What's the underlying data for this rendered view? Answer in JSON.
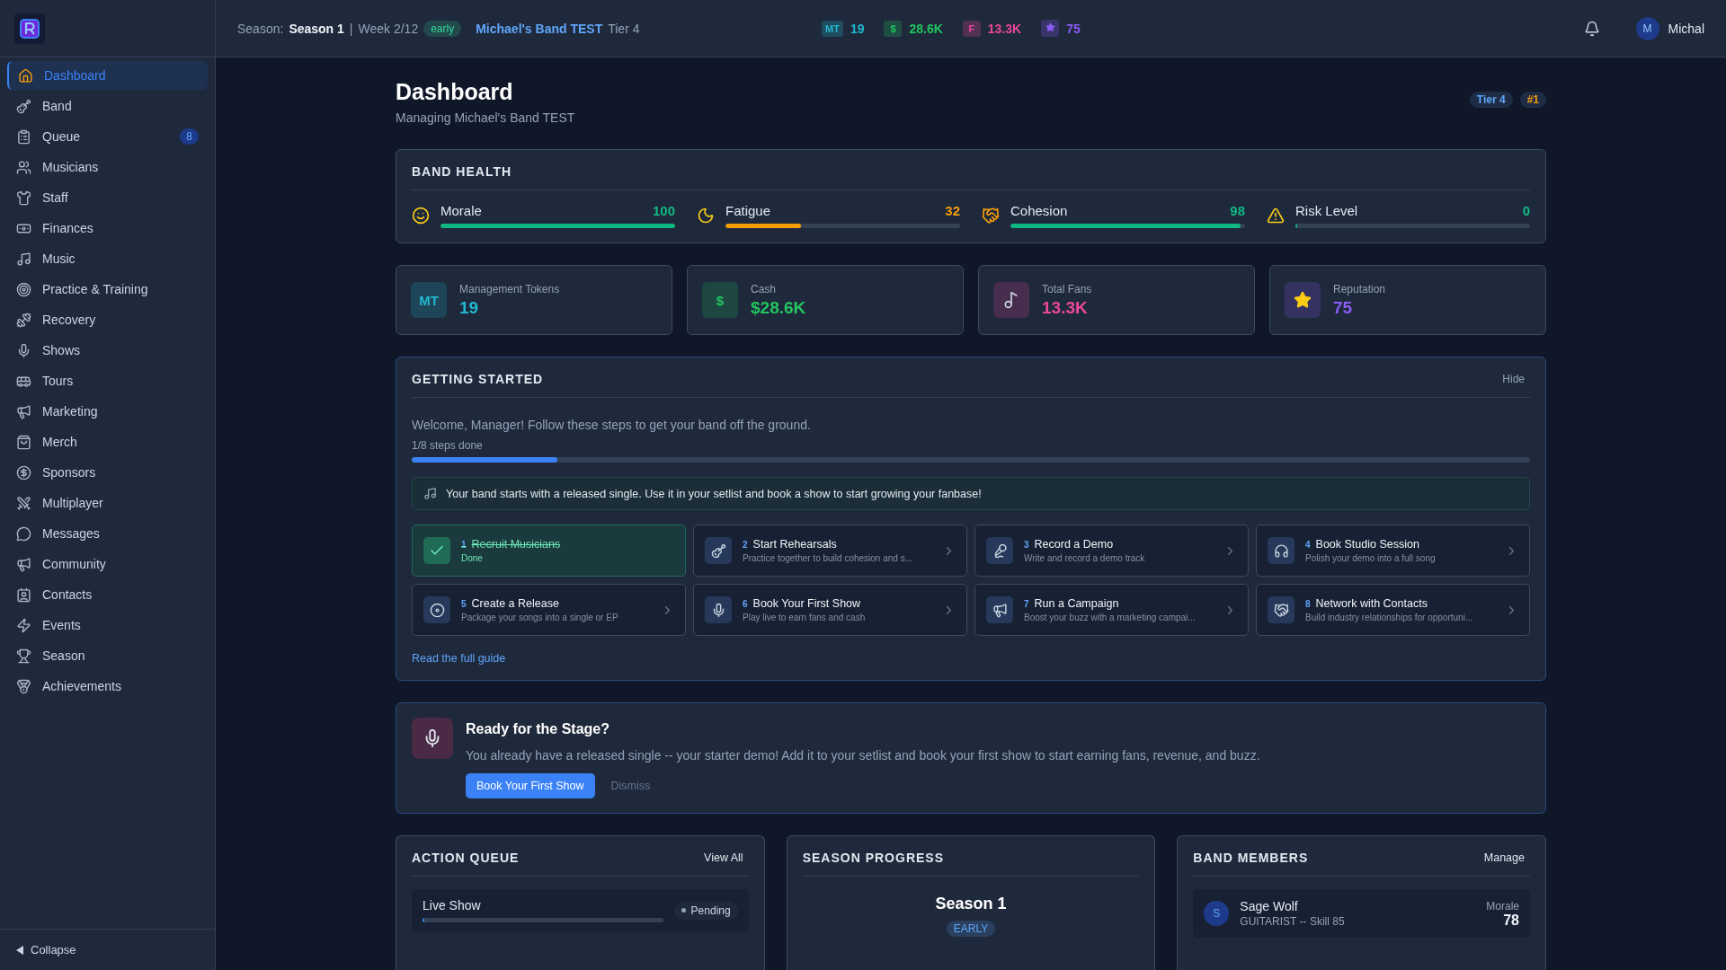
{
  "sidebar": {
    "items": [
      {
        "label": "Dashboard",
        "selected": true
      },
      {
        "label": "Band",
        "selected": false
      },
      {
        "label": "Queue",
        "selected": false,
        "badge": "8"
      },
      {
        "label": "Musicians",
        "selected": false
      },
      {
        "label": "Staff",
        "selected": false
      },
      {
        "label": "Finances",
        "selected": false
      },
      {
        "label": "Music",
        "selected": false
      },
      {
        "label": "Practice & Training",
        "selected": false
      },
      {
        "label": "Recovery",
        "selected": false
      },
      {
        "label": "Shows",
        "selected": false
      },
      {
        "label": "Tours",
        "selected": false
      },
      {
        "label": "Marketing",
        "selected": false
      },
      {
        "label": "Merch",
        "selected": false
      },
      {
        "label": "Sponsors",
        "selected": false
      },
      {
        "label": "Multiplayer",
        "selected": false
      },
      {
        "label": "Messages",
        "selected": false
      },
      {
        "label": "Community",
        "selected": false
      },
      {
        "label": "Contacts",
        "selected": false
      },
      {
        "label": "Events",
        "selected": false
      },
      {
        "label": "Season",
        "selected": false
      },
      {
        "label": "Achievements",
        "selected": false
      }
    ],
    "collapse": "Collapse"
  },
  "top_bar": {
    "season_label": "Season:",
    "season": "Season 1",
    "separator": "|",
    "week": "Week 2/12",
    "phase": "early",
    "band": "Michael's Band TEST",
    "tier": "Tier 4",
    "stats": [
      {
        "kind": "text",
        "tag": "MT",
        "value": "19",
        "color": "#22b8cf"
      },
      {
        "kind": "text",
        "tag": "$",
        "value": "28.6K",
        "color": "#22c55e"
      },
      {
        "kind": "text",
        "tag": "F",
        "value": "13.3K",
        "color": "#ec4899"
      },
      {
        "kind": "star",
        "value": "75",
        "color": "#8b5cf6"
      }
    ],
    "avatar": "M",
    "user": "Michal"
  },
  "header": {
    "title": "Dashboard",
    "subtitle": "Managing Michael's Band TEST",
    "badges": [
      {
        "label": "Tier 4",
        "color": "#60a5fa"
      },
      {
        "label": "#1",
        "color": "#f59e0b"
      }
    ]
  },
  "band_health": {
    "title": "BAND HEALTH",
    "metrics": [
      {
        "name": "Morale",
        "value": "100",
        "level": 1,
        "color": "#10b981"
      },
      {
        "name": "Fatigue",
        "value": "32",
        "level": 0.32,
        "color": "#f59e0b"
      },
      {
        "name": "Cohesion",
        "value": "98",
        "level": 0.98,
        "color": "#10b981"
      },
      {
        "name": "Risk Level",
        "value": "0",
        "level": 0,
        "color": "#10b981"
      }
    ]
  },
  "stat_cards": [
    {
      "kind": "text",
      "tag": "MT",
      "label": "Management Tokens",
      "value": "19",
      "color": "#22b8cf"
    },
    {
      "kind": "text",
      "tag": "$",
      "label": "Cash",
      "value": "$28.6K",
      "color": "#22c55e"
    },
    {
      "kind": "note",
      "label": "Total Fans",
      "value": "13.3K",
      "color": "#ec4899"
    },
    {
      "kind": "star",
      "label": "Reputation",
      "value": "75",
      "color": "#8b5cf6"
    }
  ],
  "getting_started": {
    "title": "GETTING STARTED",
    "hide": "Hide",
    "intro": "Welcome, Manager! Follow these steps to get your band off the ground.",
    "progress_text": "1/8 steps done",
    "level": 0.13,
    "tip": "Your band starts with a released single. Use it in your setlist and book a show to start growing your fanbase!",
    "steps": [
      {
        "number": "1",
        "title": "Recruit Musicians",
        "subtitle": "Done",
        "done": true
      },
      {
        "number": "2",
        "title": "Start Rehearsals",
        "subtitle": "Practice together to build cohesion and s...",
        "done": false
      },
      {
        "number": "3",
        "title": "Record a Demo",
        "subtitle": "Write and record a demo track",
        "done": false
      },
      {
        "number": "4",
        "title": "Book Studio Session",
        "subtitle": "Polish your demo into a full song",
        "done": false
      },
      {
        "number": "5",
        "title": "Create a Release",
        "subtitle": "Package your songs into a single or EP",
        "done": false
      },
      {
        "number": "6",
        "title": "Book Your First Show",
        "subtitle": "Play live to earn fans and cash",
        "done": false
      },
      {
        "number": "7",
        "title": "Run a Campaign",
        "subtitle": "Boost your buzz with a marketing campai...",
        "done": false
      },
      {
        "number": "8",
        "title": "Network with Contacts",
        "subtitle": "Build industry relationships for opportuni...",
        "done": false
      }
    ],
    "guide_link": "Read the full guide"
  },
  "stage_card": {
    "title": "Ready for the Stage?",
    "text": "You already have a released single -- your starter demo! Add it to your setlist and book your first show to start earning fans, revenue, and buzz.",
    "primary": "Book Your First Show",
    "dismiss": "Dismiss"
  },
  "action_queue": {
    "title": "ACTION QUEUE",
    "link": "View All",
    "items": [
      {
        "name": "Live Show",
        "status": "Pending",
        "level": 0
      }
    ]
  },
  "season_progress": {
    "title": "SEASON PROGRESS",
    "season": "Season 1",
    "phase": "EARLY"
  },
  "band_members": {
    "title": "BAND MEMBERS",
    "link": "Manage",
    "members": [
      {
        "initial": "S",
        "name": "Sage Wolf",
        "role": "GUITARIST -- Skill 85",
        "stat_label": "Morale",
        "stat": "78"
      }
    ]
  }
}
